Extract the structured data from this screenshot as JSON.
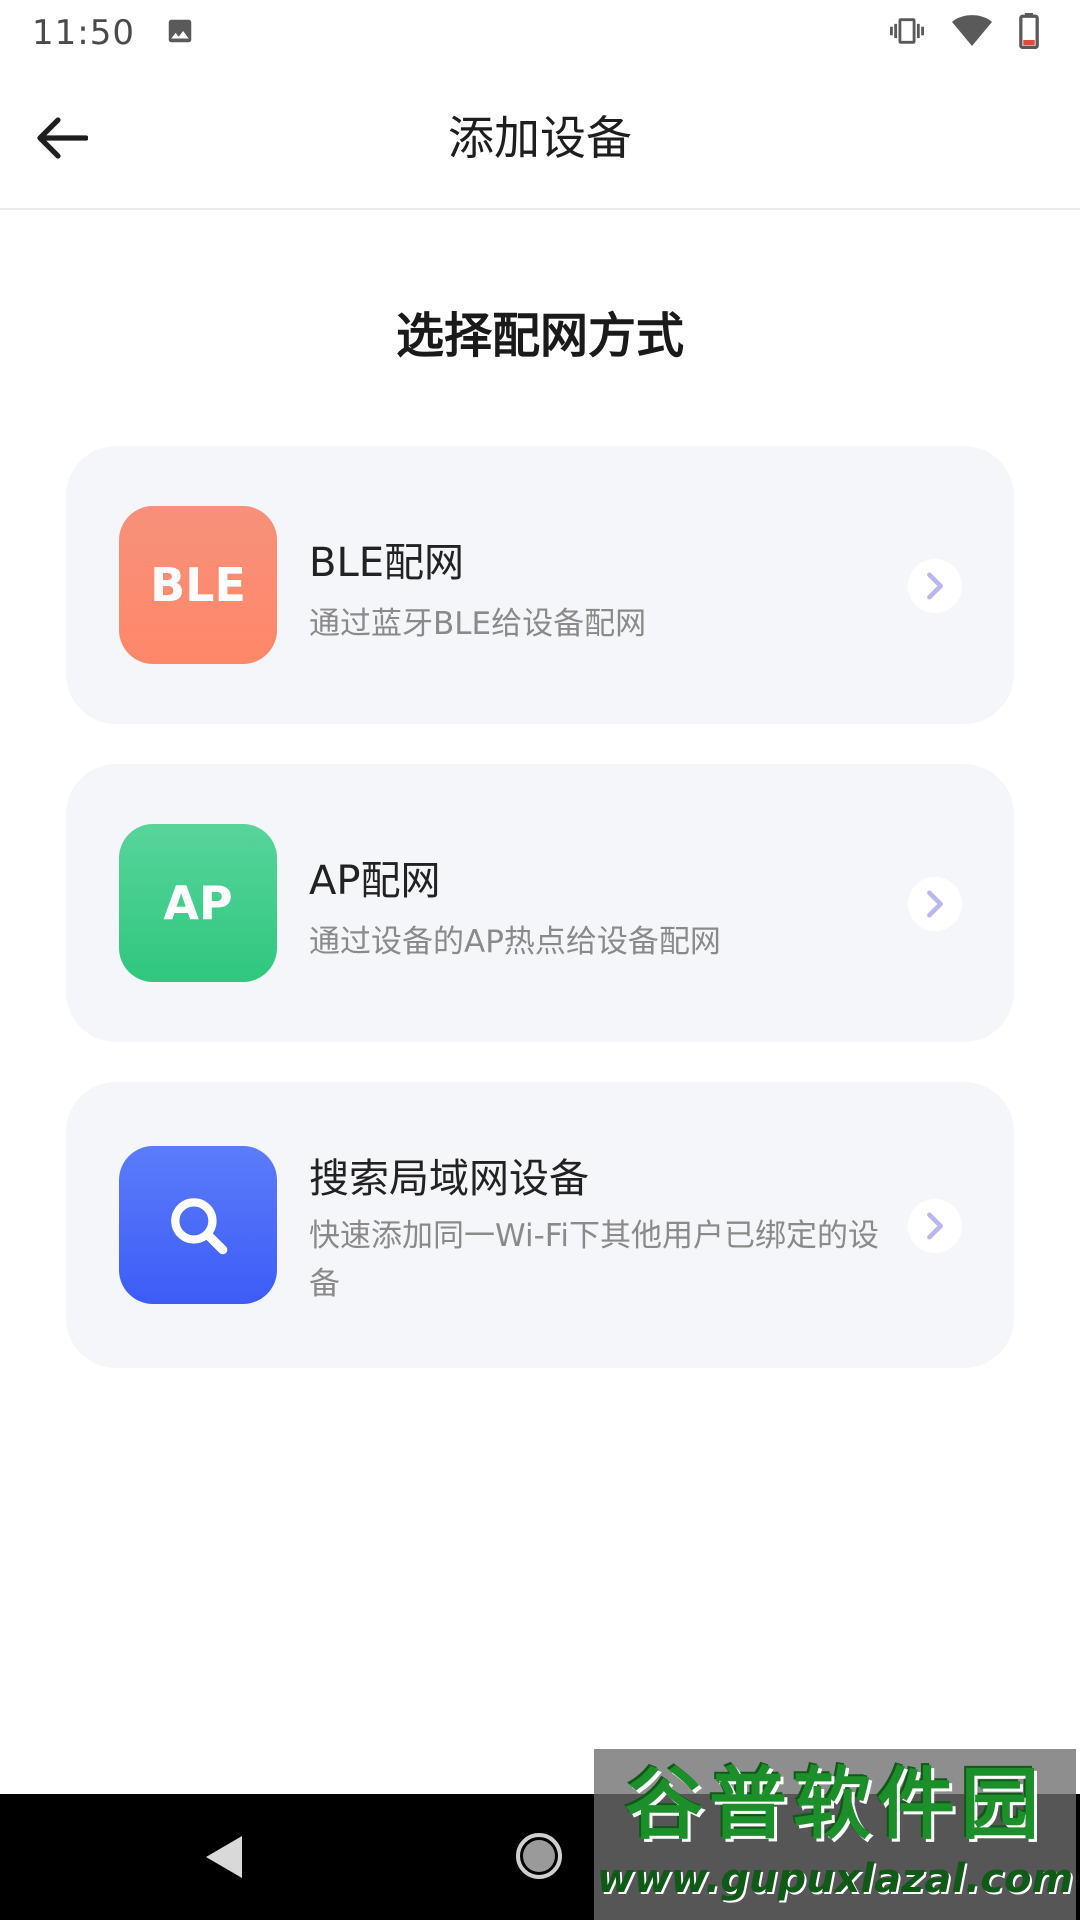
{
  "status_bar": {
    "time": "11:50",
    "icons": [
      "image-icon",
      "vibrate-icon",
      "wifi-icon",
      "battery-low-icon"
    ]
  },
  "toolbar": {
    "title": "添加设备",
    "back_icon": "arrow-left-icon"
  },
  "main": {
    "section_title": "选择配网方式",
    "options": [
      {
        "icon_label": "BLE",
        "title": "BLE配网",
        "description": "通过蓝牙BLE给设备配网",
        "icon_color": "#ff8a6f"
      },
      {
        "icon_label": "AP",
        "title": "AP配网",
        "description": "通过设备的AP热点给设备配网",
        "icon_color": "#3ccb88"
      },
      {
        "icon_name": "search-icon",
        "title": "搜索局域网设备",
        "description": "快速添加同一Wi-Fi下其他用户已绑定的设备",
        "icon_color": "#4a68f8"
      }
    ]
  },
  "nav_bar": {
    "icons": [
      "nav-back-icon",
      "nav-home-icon"
    ]
  },
  "watermark": {
    "main_text": "谷普软件园",
    "url": "www.gupuxlazal.com"
  },
  "colors": {
    "card_background": "#f5f6fa",
    "chevron": "#b9b6f0",
    "title_text": "#1e1e1e",
    "secondary_text": "#8a8a8a"
  }
}
